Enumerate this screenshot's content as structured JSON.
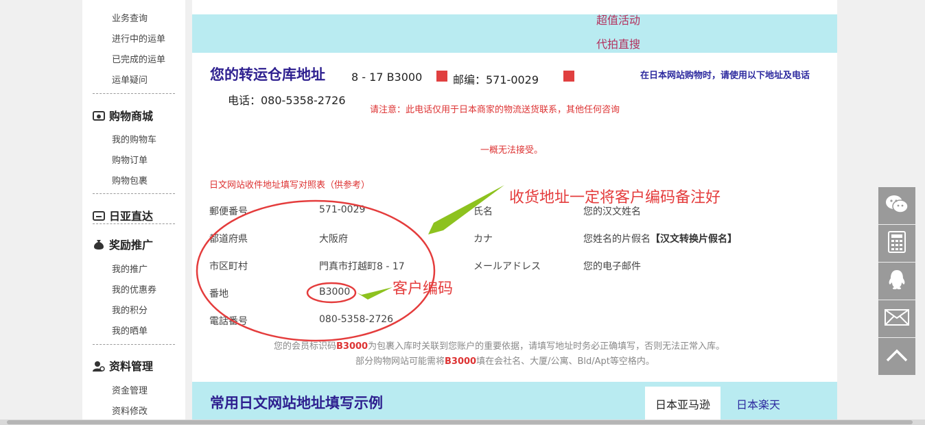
{
  "sidebar": {
    "items_top": [
      "业务查询",
      "进行中的运单",
      "已完成的运单",
      "运单疑问"
    ],
    "shop_head": "购物商城",
    "shop_items": [
      "我的购物车",
      "购物订单",
      "购物包裹"
    ],
    "jp_head": "日亚直达",
    "reward_head": "奖励推广",
    "reward_items": [
      "我的推广",
      "我的优惠券",
      "我的积分",
      "我的晒单"
    ],
    "profile_head": "资料管理",
    "profile_items": [
      "资金管理",
      "资料修改"
    ]
  },
  "top_links": [
    "超值活动",
    "代拍直搜"
  ],
  "address": {
    "title": "您的转运仓库地址",
    "line": "8 - 17 B3000",
    "zip_label": "邮编：571-0029",
    "phone": "电话：080-5358-2726",
    "hint_right": "在日本网站购物时，请使用以下地址及电话",
    "note1": "请注意：此电话仅用于日本商家的物流送货联系，其他任何咨询",
    "note2": "一概无法接受。"
  },
  "ref": {
    "title": "日文网站收件地址填写对照表（供参考）",
    "rows": [
      {
        "k": "郵便番号",
        "v": "571-0029",
        "k2": "氏名",
        "v2": "您的汉文姓名"
      },
      {
        "k": "都道府県",
        "v": "大阪府",
        "k2": "カナ",
        "v2": "您姓名的片假名",
        "v2b": "【汉文转换片假名】"
      },
      {
        "k": "市区町村",
        "v": "門真市打越町8 - 17",
        "k2": "メールアドレス",
        "v2": "您的电子邮件"
      },
      {
        "k": "番地",
        "v": "B3000"
      },
      {
        "k": "電話番号",
        "v": "080-5358-2726"
      }
    ],
    "bottom1_a": "您的会员标识码",
    "bottom1_code": "B3000",
    "bottom1_b": "为包裹入库时关联到您账户的重要依据，请填写地址时务必正确填写，否则无法正常入库。",
    "bottom2_a": "部分购物网站可能需将",
    "bottom2_code": "B3000",
    "bottom2_b": "填在会社名、大厦/公寓、Bld/Apt等空格内。"
  },
  "annotations": {
    "address_tip": "收货地址一定将客户编码备注好",
    "code_tip": "客户编码"
  },
  "examples": {
    "title": "常用日文网站地址填写示例",
    "tabs": [
      "日本亚马逊",
      "日本楽天"
    ]
  },
  "float_icons": [
    "wechat-icon",
    "calculator-icon",
    "qq-icon",
    "mail-icon",
    "back-to-top-icon"
  ],
  "colors": {
    "band": "#b9ebf1",
    "title": "#2d1f8f",
    "accent_red": "#e43c3c",
    "arrow": "#8dc21f"
  }
}
